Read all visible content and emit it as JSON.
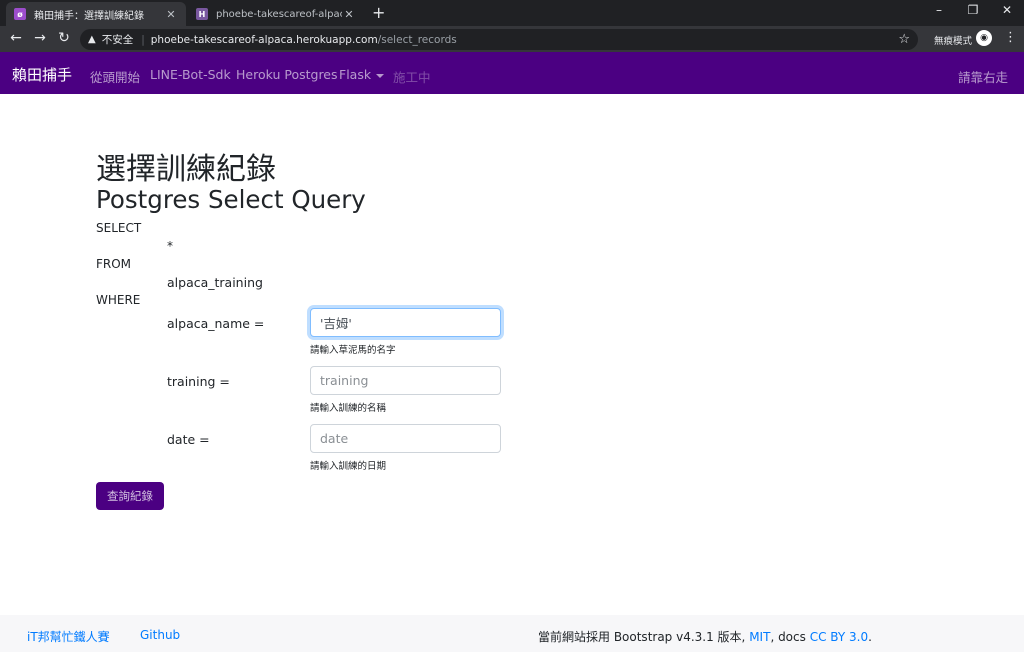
{
  "browser": {
    "tabs": [
      {
        "title": "賴田捕手：選擇訓練紀錄",
        "favicon": "alpaca-favicon",
        "active": true
      },
      {
        "title": "phoebe-takescareof-alpaca · Log",
        "favicon": "heroku-favicon",
        "active": false
      }
    ],
    "new_tab": "+",
    "window_controls": {
      "minimize": "–",
      "restore": "❐",
      "close": "✕"
    },
    "nav": {
      "back": "←",
      "forward": "→",
      "reload": "↻"
    },
    "address": {
      "security_icon": "▲",
      "security_label": "不安全",
      "host": "phoebe-takescareof-alpaca.herokuapp.com",
      "path": "/select_records"
    },
    "bookmark_star": "☆",
    "incognito_label": "無痕模式",
    "menu": "⋮"
  },
  "navbar": {
    "brand": "賴田捕手",
    "links": [
      "從頭開始",
      "LINE-Bot-Sdk",
      "Heroku Postgres",
      "Flask",
      "施工中"
    ],
    "right": "請靠右走",
    "background": "#4b0082"
  },
  "page": {
    "title": "選擇訓練紀錄",
    "subtitle": "Postgres Select Query",
    "query": {
      "select_kw": "SELECT",
      "select_val": "*",
      "from_kw": "FROM",
      "from_val": "alpaca_training",
      "where_kw": "WHERE"
    },
    "fields": [
      {
        "label": "alpaca_name =",
        "value": "'吉姆'",
        "placeholder": "",
        "help": "請輸入草泥馬的名字"
      },
      {
        "label": "training =",
        "value": "",
        "placeholder": "training",
        "help": "請輸入訓練的名稱"
      },
      {
        "label": "date =",
        "value": "",
        "placeholder": "date",
        "help": "請輸入訓練的日期"
      }
    ],
    "submit_label": "查詢紀錄"
  },
  "footer": {
    "links": [
      "iT邦幫忙鐵人賽",
      "Github"
    ],
    "credit_prefix": "當前網站採用 Bootstrap v4.3.1 版本, ",
    "mit": "MIT",
    "credit_mid": ", docs ",
    "cc": "CC BY 3.0",
    "credit_suffix": "."
  }
}
